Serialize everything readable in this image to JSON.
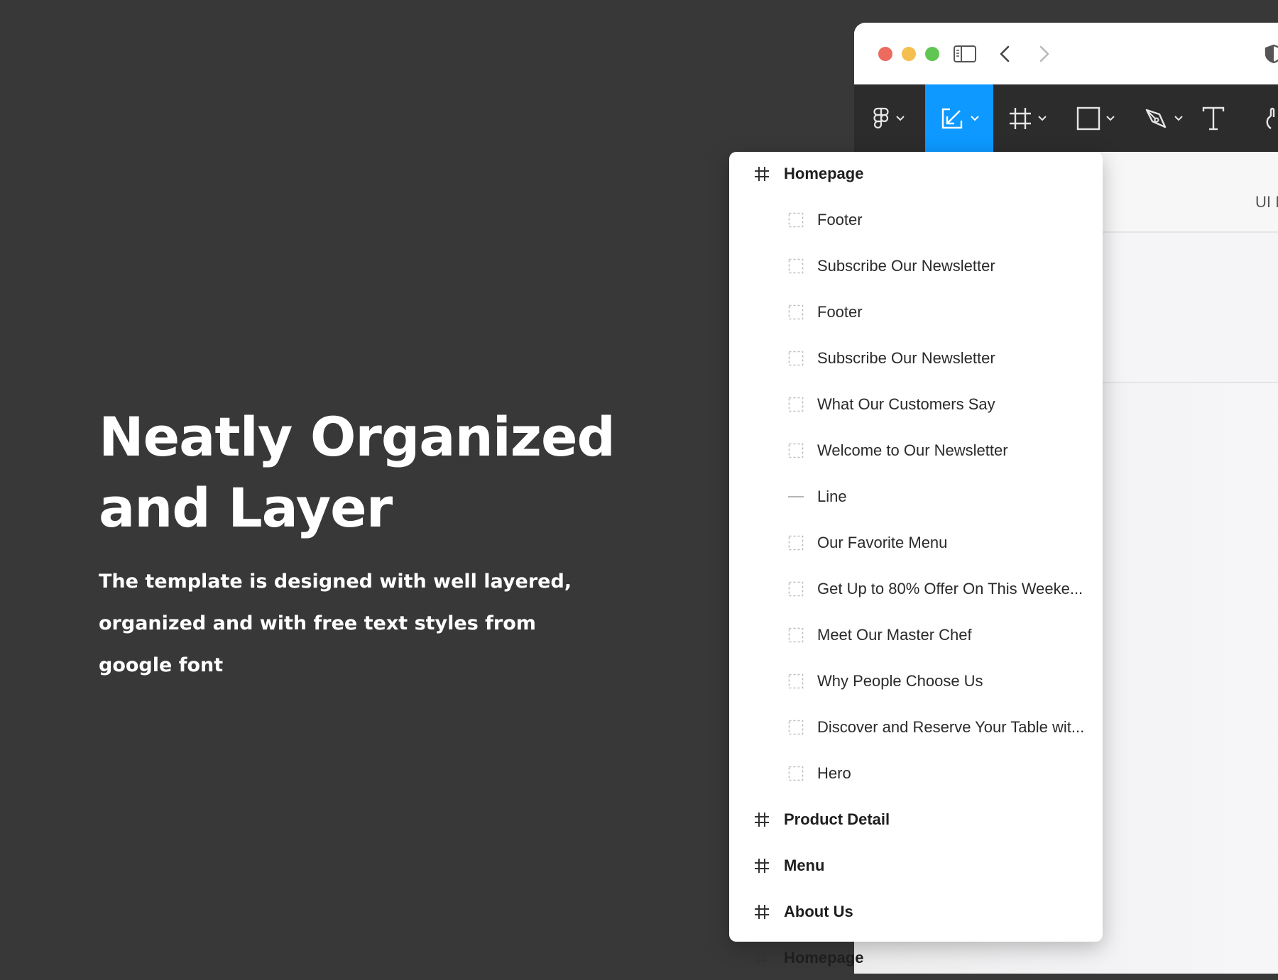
{
  "promo": {
    "title_line1": "Neatly Organized",
    "title_line2": "and Layer",
    "desc_line1": "The template is designed with well layered,",
    "desc_line2": "organized and with free text styles from",
    "desc_line3": "google font"
  },
  "window": {
    "canvas_tab": "UI I"
  },
  "layers": [
    {
      "kind": "frame",
      "label": "Homepage"
    },
    {
      "kind": "group",
      "label": "Footer"
    },
    {
      "kind": "group",
      "label": "Subscribe Our Newsletter"
    },
    {
      "kind": "group",
      "label": "Footer"
    },
    {
      "kind": "group",
      "label": "Subscribe Our Newsletter"
    },
    {
      "kind": "group",
      "label": "What Our Customers Say"
    },
    {
      "kind": "group",
      "label": "Welcome to Our Newsletter"
    },
    {
      "kind": "line",
      "label": "Line"
    },
    {
      "kind": "group",
      "label": "Our Favorite Menu"
    },
    {
      "kind": "group",
      "label": "Get Up to 80% Offer On This Weeke..."
    },
    {
      "kind": "group",
      "label": "Meet Our Master Chef"
    },
    {
      "kind": "group",
      "label": "Why People Choose Us"
    },
    {
      "kind": "group",
      "label": "Discover and Reserve Your Table wit..."
    },
    {
      "kind": "group",
      "label": "Hero"
    },
    {
      "kind": "frame",
      "label": "Product Detail"
    },
    {
      "kind": "frame",
      "label": "Menu"
    },
    {
      "kind": "frame",
      "label": "About Us"
    },
    {
      "kind": "frame",
      "label": "Homepage"
    }
  ],
  "colors": {
    "background": "#383838",
    "toolbar": "#2c2c2c",
    "accent": "#0d99ff",
    "traffic_red": "#ed6a5e",
    "traffic_yellow": "#f4bf4f",
    "traffic_green": "#61c554"
  }
}
